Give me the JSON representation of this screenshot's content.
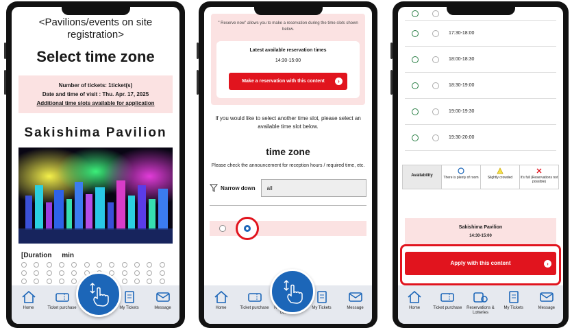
{
  "nav": [
    {
      "label": "Home",
      "icon": "home-icon"
    },
    {
      "label": "Ticket purchase",
      "icon": "ticket-icon"
    },
    {
      "label": "Reservations & Lotteries",
      "icon": "reservation-icon"
    },
    {
      "label": "My Tickets",
      "icon": "my-tickets-icon"
    },
    {
      "label": "Message",
      "icon": "message-icon"
    }
  ],
  "screen1": {
    "heading": "<Pavilions/events on site registration>",
    "title": "Select time zone",
    "tickets": "Number of tickets: 1ticket(s)",
    "visit": "Date and time of visit : Thu. Apr. 17, 2025",
    "additional_link": "Additional time slots available for application",
    "pavilion": "Sakishima Pavilion",
    "duration": "[Duration",
    "duration_suffix": "min"
  },
  "screen2": {
    "note": "\" Reserve now\" allows you to make a reservation during the time slots shown below.",
    "latest_label": "Latest available reservation times",
    "latest_time": "14:30-15:00",
    "reserve_button": "Make a reservation with this content",
    "other_slot": "If you would like to select another time slot, please select an available time slot below.",
    "timezone_title": "time zone",
    "check_note": "Please check the announcement for reception hours / required time, etc.",
    "narrow_label": "Narrow down",
    "narrow_value": "all"
  },
  "screen3": {
    "slots": [
      "17:30-18:00",
      "18:00-18:30",
      "18:30-19:00",
      "19:00-19:30",
      "19:30-20:00"
    ],
    "legend": {
      "availability": "Availability",
      "plenty": "There is plenty of room",
      "crowded": "Slightly crowded",
      "full": "It's full (Reservations not possible)"
    },
    "pavilion": "Sakishima Pavilion",
    "time": "14:30-15:00",
    "apply_button": "Apply with this content"
  },
  "colors": {
    "accent_red": "#e1141e",
    "pink_bg": "#fbe2e2",
    "hand_blue": "#1c66b8",
    "available_green": "#2a7f45"
  }
}
